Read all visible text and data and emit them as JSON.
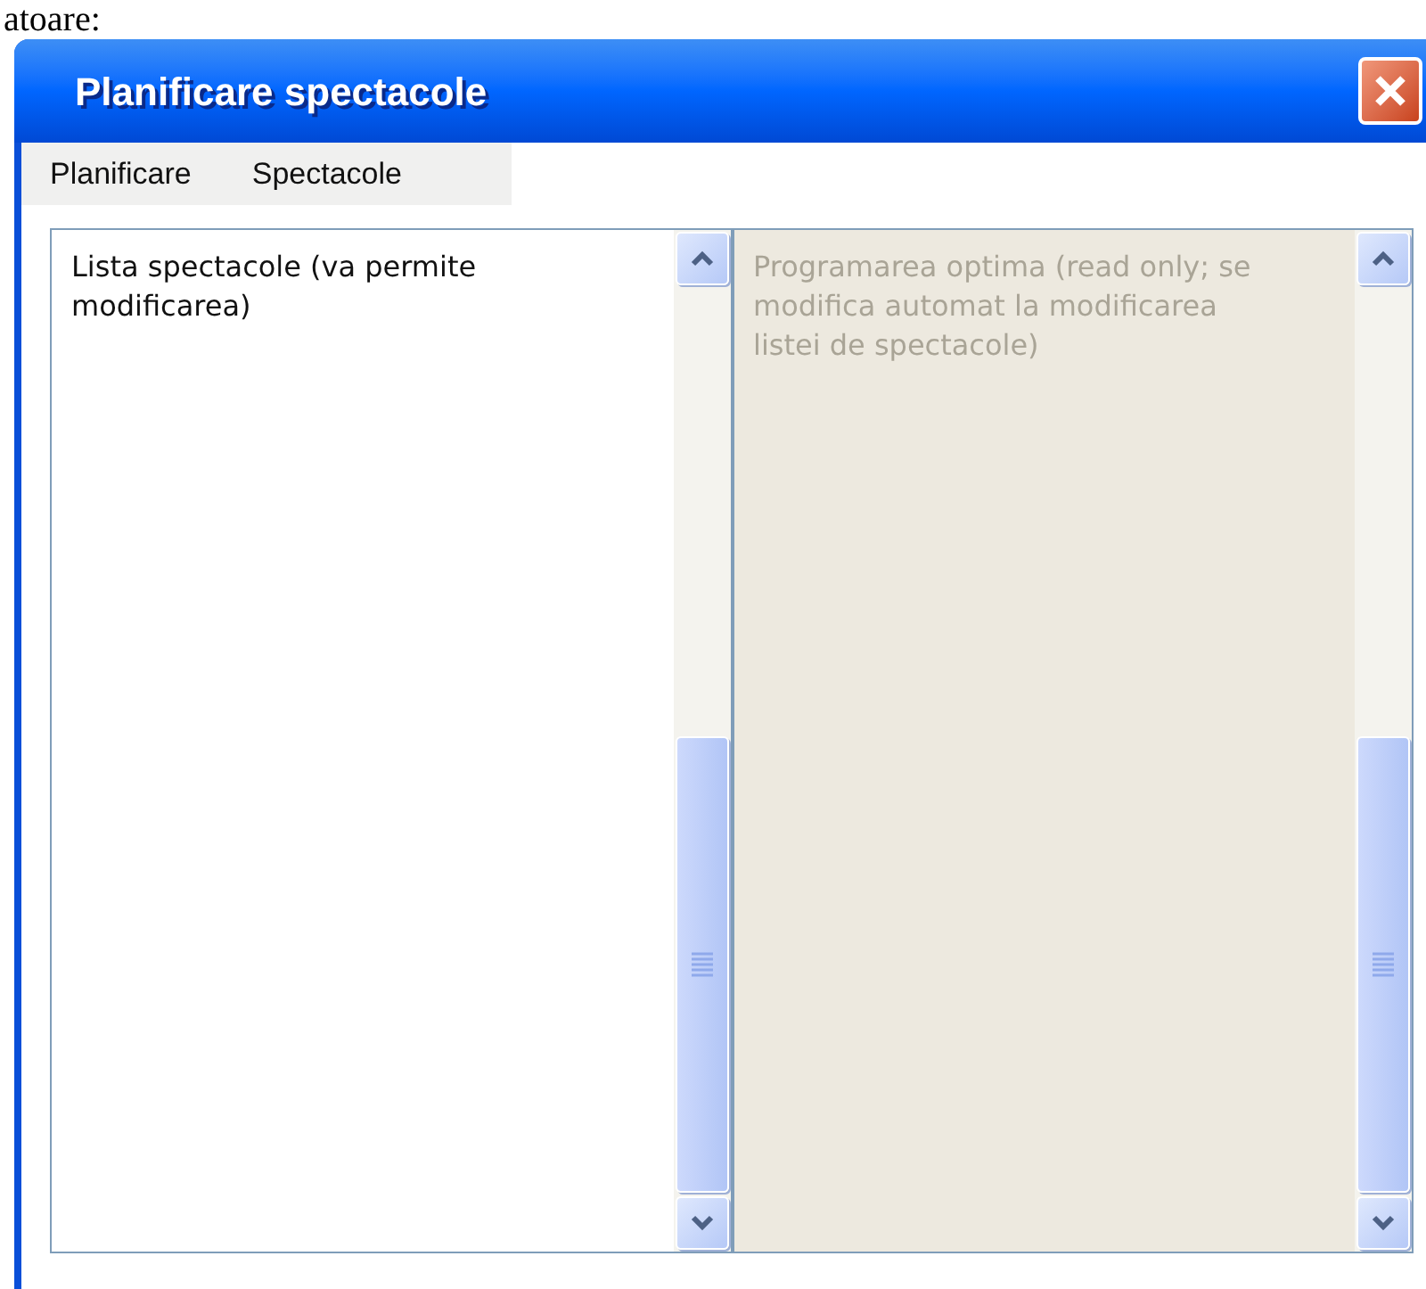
{
  "above_text": "atoare:",
  "window": {
    "title": "Planificare spectacole"
  },
  "menu": [
    {
      "label": "Planificare"
    },
    {
      "label": "Spectacole"
    }
  ],
  "panels": [
    {
      "text": "Lista spectacole (va permite modificarea)",
      "read_only": false
    },
    {
      "text": "Programarea optima (read only; se modifica automat la modificarea listei de spectacole)",
      "read_only": true
    }
  ]
}
